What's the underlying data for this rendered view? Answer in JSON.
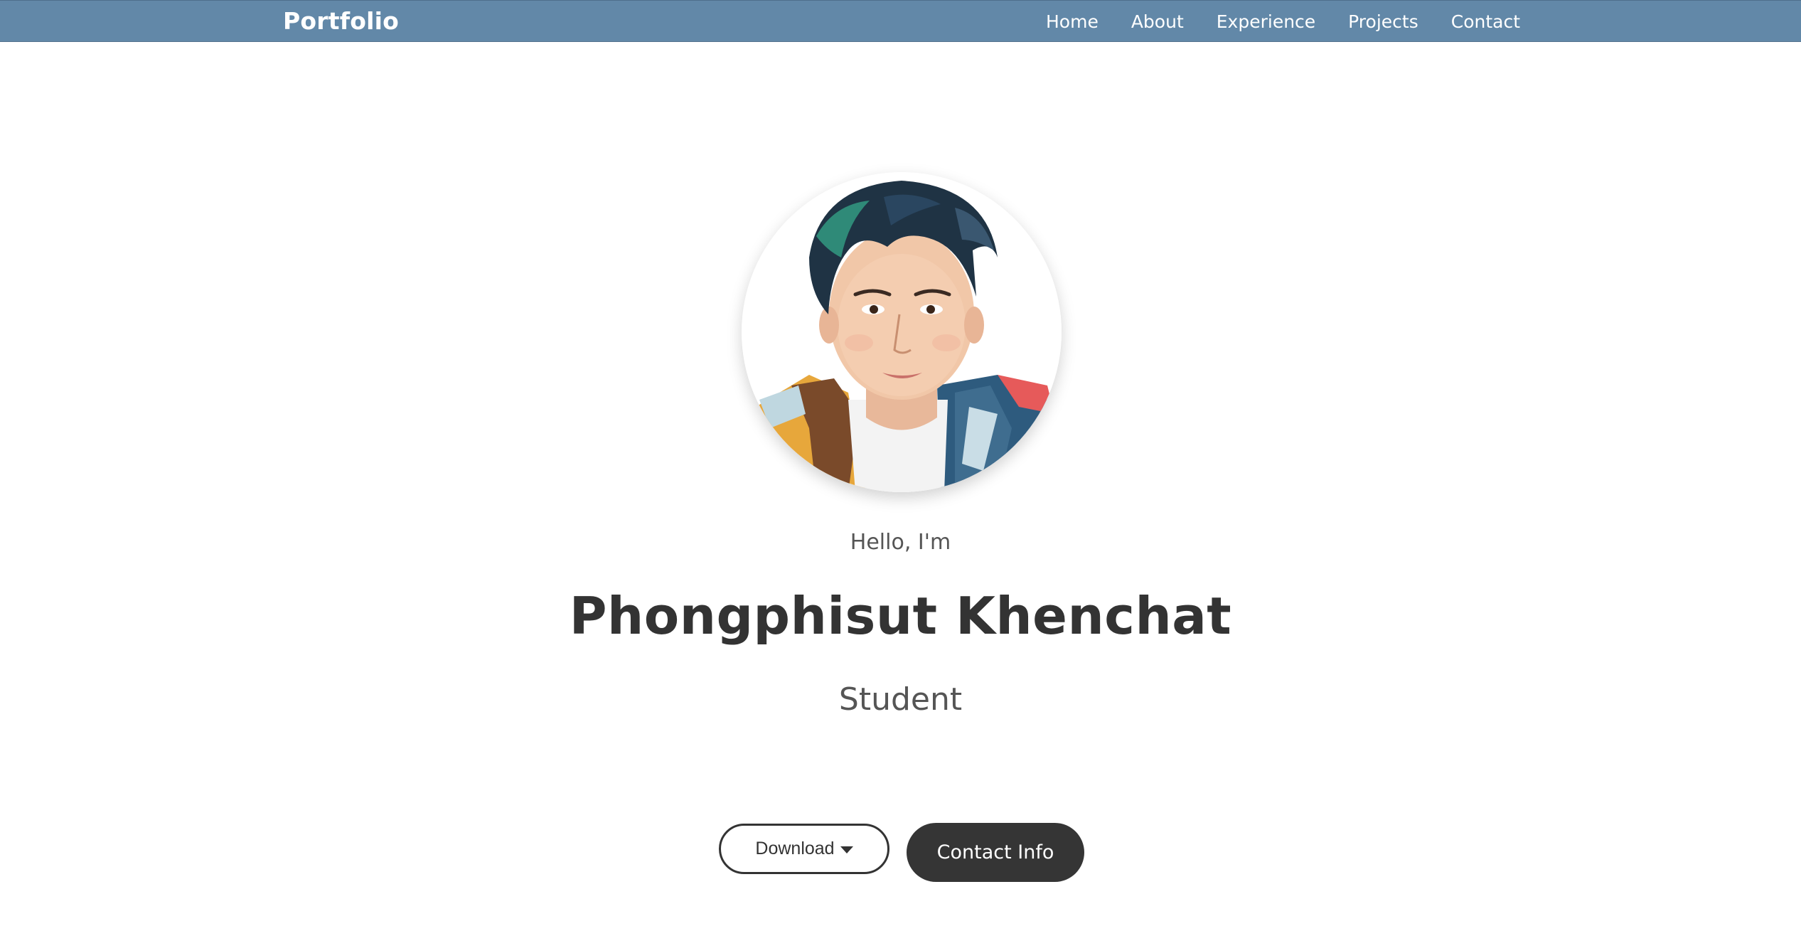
{
  "nav": {
    "brand": "Portfolio",
    "links": [
      "Home",
      "About",
      "Experience",
      "Projects",
      "Contact"
    ]
  },
  "hero": {
    "greeting": "Hello, I'm",
    "name": "Phongphisut Khenchat",
    "role": "Student",
    "avatar_alt": "portrait-painting",
    "download_label": "Download",
    "contact_label": "Contact Info"
  },
  "colors": {
    "navbar_bg": "#6288a8",
    "primary_text": "#333333",
    "secondary_text": "#555555",
    "button_dark": "#353535"
  },
  "icons": {
    "download_caret": "caret-down-icon"
  }
}
